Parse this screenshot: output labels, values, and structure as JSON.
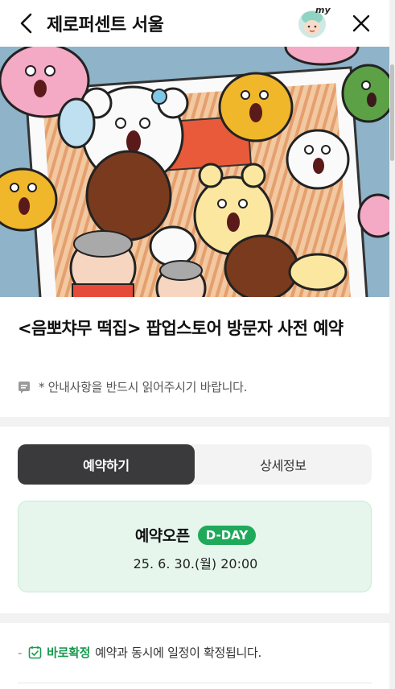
{
  "header": {
    "title": "제로퍼센트 서울",
    "my_label": "my"
  },
  "event": {
    "title": "<음뽀챠무 떡집> 팝업스토어 방문자 사전 예약",
    "notice": "* 안내사항을 반드시 읽어주시기 바랍니다."
  },
  "tabs": [
    {
      "label": "예약하기",
      "active": true
    },
    {
      "label": "상세정보",
      "active": false
    }
  ],
  "open_card": {
    "label": "예약오픈",
    "badge": "D-DAY",
    "date": "25. 6. 30.(월) 20:00"
  },
  "confirm": {
    "strong": "바로확정",
    "text": "예약과 동시에 일정이 확정됩니다."
  },
  "colors": {
    "accent_green": "#1eaa5a",
    "card_bg": "#e6f6ec",
    "tab_active": "#3a3a3c"
  }
}
